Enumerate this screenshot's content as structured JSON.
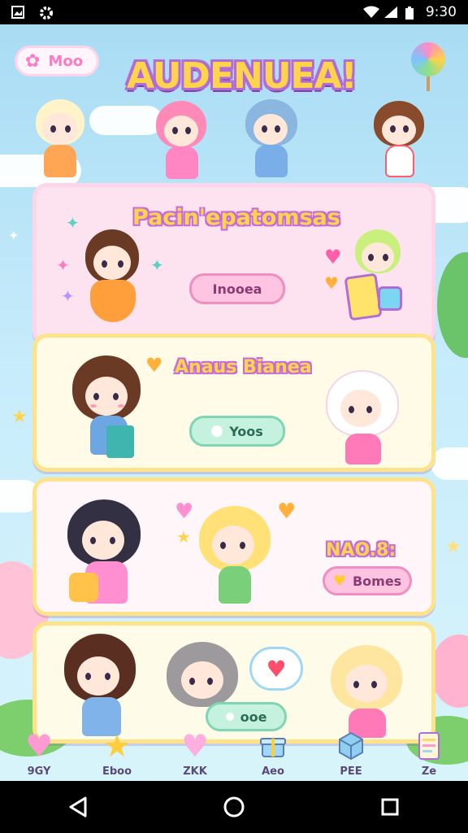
{
  "status_bar": {
    "time": "9:30"
  },
  "header": {
    "pill_label": "Moo",
    "app_title": "AUDENUEA!"
  },
  "cards": [
    {
      "title": "Pacin'epatomsas",
      "button": "Inooea"
    },
    {
      "title": "Anaus Bianea",
      "button": "Yoos"
    },
    {
      "title": "NAO.8:",
      "title_prefix": "8",
      "button": "Bomes"
    },
    {
      "button": "ooe"
    }
  ],
  "tabs": [
    {
      "label": "9GY",
      "icon": "heart-icon",
      "color": "#ff9ad2"
    },
    {
      "label": "Eboo",
      "icon": "star-icon",
      "color": "#ffcd3c"
    },
    {
      "label": "ZKK",
      "icon": "heart-icon",
      "color": "#ffaee0"
    },
    {
      "label": "Aeo",
      "icon": "gift-icon",
      "color": "#9fd7f5"
    },
    {
      "label": "PEE",
      "icon": "cube-icon",
      "color": "#8fd0f0"
    },
    {
      "label": "Ze",
      "icon": "notebook-icon",
      "color": "#ffd76a"
    }
  ],
  "colors": {
    "accent_pink": "#ff7ac4",
    "accent_yellow": "#ffd44d",
    "accent_purple": "#b36bd6"
  }
}
